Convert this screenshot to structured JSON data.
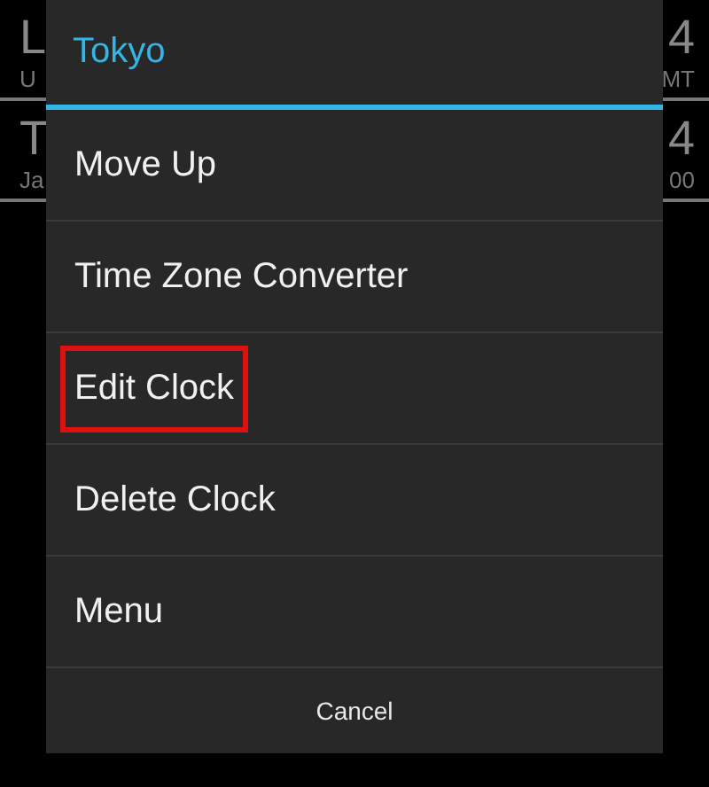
{
  "background_list": [
    {
      "title": "L",
      "subtitle": "U",
      "time": "4",
      "zone": "MT"
    },
    {
      "title": "T",
      "subtitle": "Ja",
      "time": "4",
      "zone": "00"
    }
  ],
  "dialog": {
    "title": "Tokyo",
    "items": [
      {
        "label": "Move Up",
        "highlighted": false
      },
      {
        "label": "Time Zone Converter",
        "highlighted": false
      },
      {
        "label": "Edit Clock",
        "highlighted": true
      },
      {
        "label": "Delete Clock",
        "highlighted": false
      },
      {
        "label": "Menu",
        "highlighted": false
      }
    ],
    "cancel": "Cancel"
  }
}
